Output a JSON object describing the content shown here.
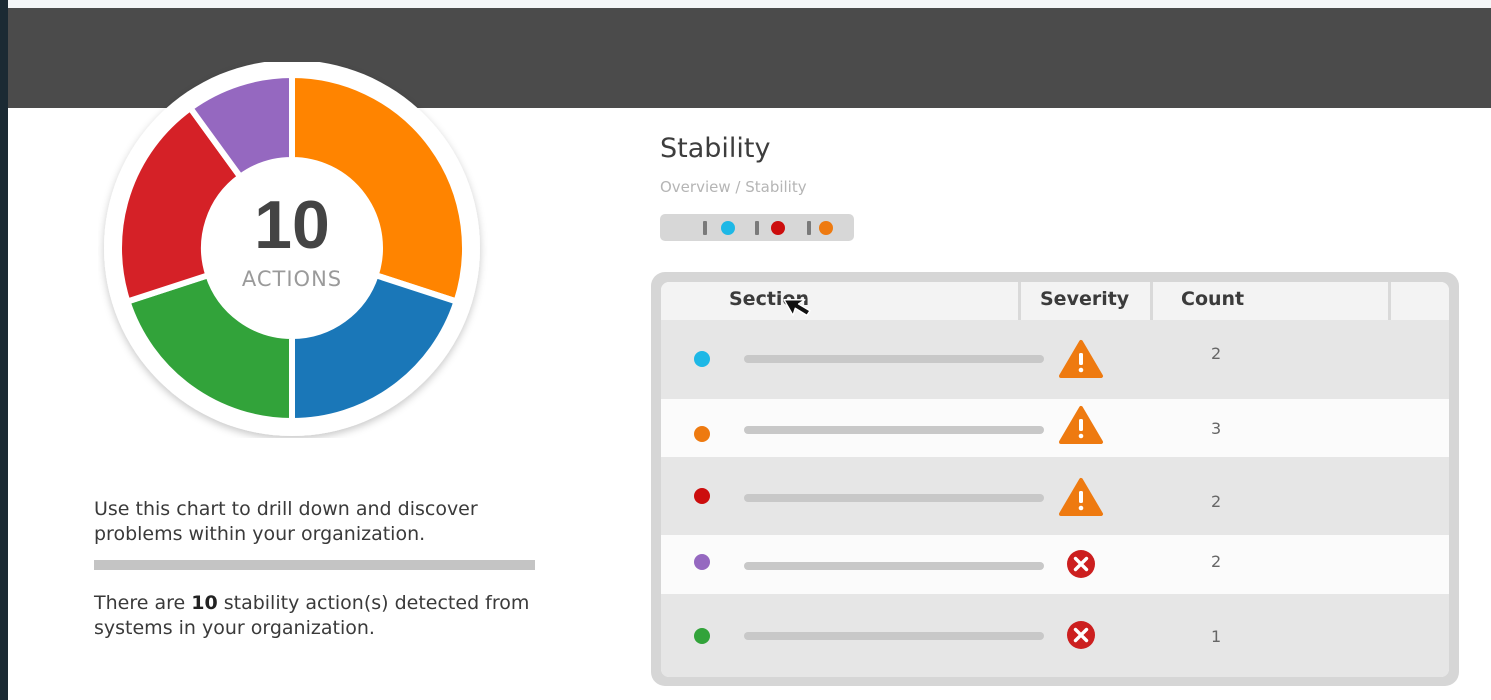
{
  "colors": {
    "header": "#4b4b4b",
    "orange": "#ff8400",
    "blue": "#1a77b8",
    "green": "#32a33a",
    "red": "#d52127",
    "purple": "#9568c0",
    "cyan": "#1eb8e6",
    "dark_red": "#cc0d0d",
    "warning": "#ee7a10",
    "error": "#cc1f1f"
  },
  "donut": {
    "total": "10",
    "label": "ACTIONS",
    "segments": [
      {
        "name": "orange",
        "color": "#ff8400",
        "value": 3
      },
      {
        "name": "blue",
        "color": "#1a77b8",
        "value": 2
      },
      {
        "name": "green",
        "color": "#32a33a",
        "value": 2
      },
      {
        "name": "red",
        "color": "#d52127",
        "value": 2
      },
      {
        "name": "purple",
        "color": "#9568c0",
        "value": 1
      }
    ]
  },
  "description": {
    "line1": "Use this chart to drill down and discover problems within your organization.",
    "line2_prefix": "There are ",
    "line2_count": "10",
    "line2_suffix": " stability action(s) detected from systems in your organization."
  },
  "page": {
    "title": "Stability",
    "breadcrumb_root": "Overview",
    "breadcrumb_sep": " / ",
    "breadcrumb_current": "Stability"
  },
  "filters": {
    "dots": [
      "#1eb8e6",
      "#cc0d0d",
      "#ee7a10"
    ]
  },
  "table": {
    "headers": {
      "section": "Section",
      "severity": "Severity",
      "count": "Count"
    },
    "rows": [
      {
        "dot": "#1eb8e6",
        "severity": "warning",
        "count": "2"
      },
      {
        "dot": "#ee7a10",
        "severity": "warning",
        "count": "3"
      },
      {
        "dot": "#cc0d0d",
        "severity": "warning",
        "count": "2"
      },
      {
        "dot": "#9568c0",
        "severity": "error",
        "count": "2"
      },
      {
        "dot": "#32a33a",
        "severity": "error",
        "count": "1"
      }
    ]
  },
  "icons": {
    "warning": "warning-icon",
    "error": "error-icon",
    "cursor": "mouse-pointer-icon"
  }
}
